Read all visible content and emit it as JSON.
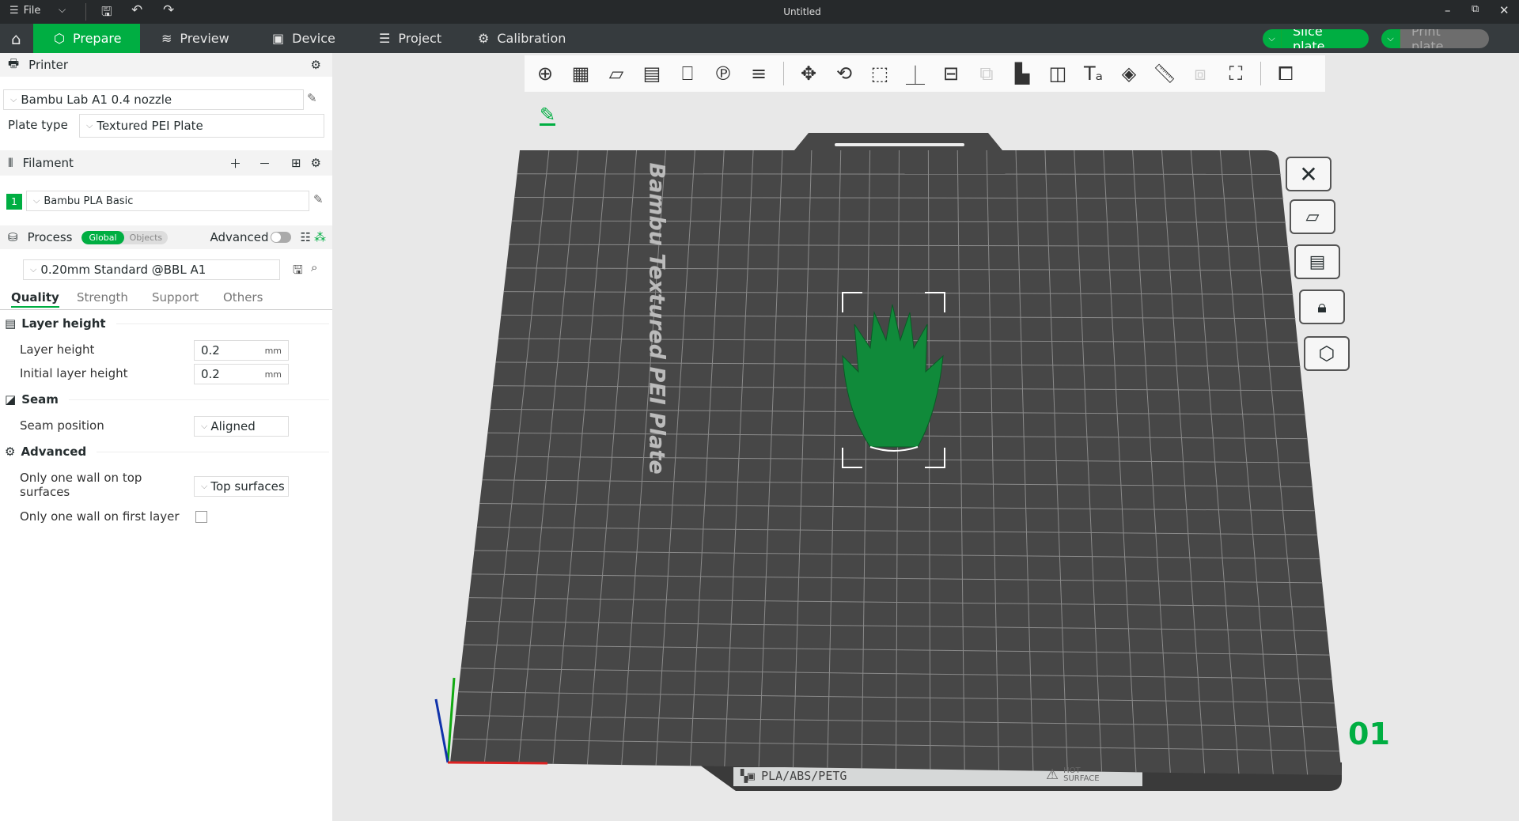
{
  "titlebar": {
    "file_label": "File",
    "title": "Untitled"
  },
  "tabs": [
    {
      "label": "Prepare"
    },
    {
      "label": "Preview"
    },
    {
      "label": "Device"
    },
    {
      "label": "Project"
    },
    {
      "label": "Calibration"
    }
  ],
  "actions": {
    "slice": "Slice plate",
    "print": "Print plate"
  },
  "printer": {
    "header": "Printer",
    "preset": "Bambu Lab A1 0.4 nozzle",
    "plate_type_label": "Plate type",
    "plate_type": "Textured PEI Plate"
  },
  "filament": {
    "header": "Filament",
    "slot": "1",
    "name": "Bambu PLA Basic"
  },
  "process": {
    "header": "Process",
    "global": "Global",
    "objects": "Objects",
    "advanced": "Advanced",
    "preset": "0.20mm Standard @BBL A1",
    "tabs": [
      "Quality",
      "Strength",
      "Support",
      "Others"
    ],
    "sections": {
      "layer": "Layer height",
      "seam": "Seam",
      "advanced": "Advanced"
    },
    "fields": {
      "layer_height": {
        "label": "Layer height",
        "value": "0.2",
        "unit": "mm"
      },
      "initial_layer_height": {
        "label": "Initial layer height",
        "value": "0.2",
        "unit": "mm"
      },
      "seam_position": {
        "label": "Seam position",
        "value": "Aligned"
      },
      "one_wall_top": {
        "label_1": "Only one wall on top",
        "label_2": "surfaces",
        "value": "Top surfaces"
      },
      "one_wall_first": {
        "label": "Only one wall on first layer",
        "checked": false
      }
    }
  },
  "plate": {
    "label": "Bambu Textured PEI Plate",
    "number": "01",
    "strip_text": "PLA/ABS/PETG",
    "hot_1": "HOT",
    "hot_2": "SURFACE"
  },
  "colors": {
    "accent": "#00ae42",
    "plate": "#474747"
  },
  "toolbar_icons": [
    "add-object-icon",
    "add-plate-icon",
    "auto-orient-icon",
    "arrange-icon",
    "split-objects-icon",
    "split-parts-icon",
    "layers-icon",
    "|",
    "move-icon",
    "rotate-icon",
    "scale-icon",
    "lay-on-face-icon",
    "cut-icon",
    "boolean-icon",
    "support-paint-icon",
    "seam-paint-icon",
    "text-icon",
    "color-paint-icon",
    "measure-icon",
    "assembly-icon",
    "fit-view-icon",
    "|",
    "puzzle-icon"
  ]
}
